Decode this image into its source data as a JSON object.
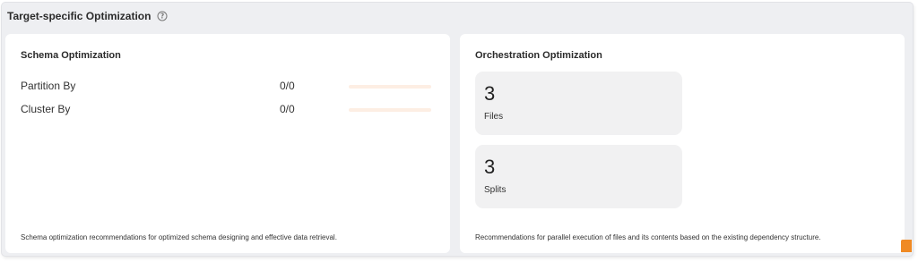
{
  "header": {
    "title": "Target-specific Optimization",
    "help_icon": "question-circle-icon"
  },
  "schema": {
    "title": "Schema Optimization",
    "rows": [
      {
        "label": "Partition By",
        "value": "0/0",
        "progress": 0
      },
      {
        "label": "Cluster By",
        "value": "0/0",
        "progress": 0
      }
    ],
    "footer": "Schema optimization recommendations for optimized schema designing and effective data retrieval."
  },
  "orchestration": {
    "title": "Orchestration Optimization",
    "stats": [
      {
        "value": "3",
        "label": "Files"
      },
      {
        "value": "3",
        "label": "Splits"
      }
    ],
    "footer": "Recommendations for parallel execution of files and its contents based on the existing dependency structure."
  },
  "colors": {
    "accent": "#f08a24",
    "bar_track": "#fdeee3",
    "panel_bg": "#eeeff2",
    "stat_bg": "#f1f1f2"
  }
}
